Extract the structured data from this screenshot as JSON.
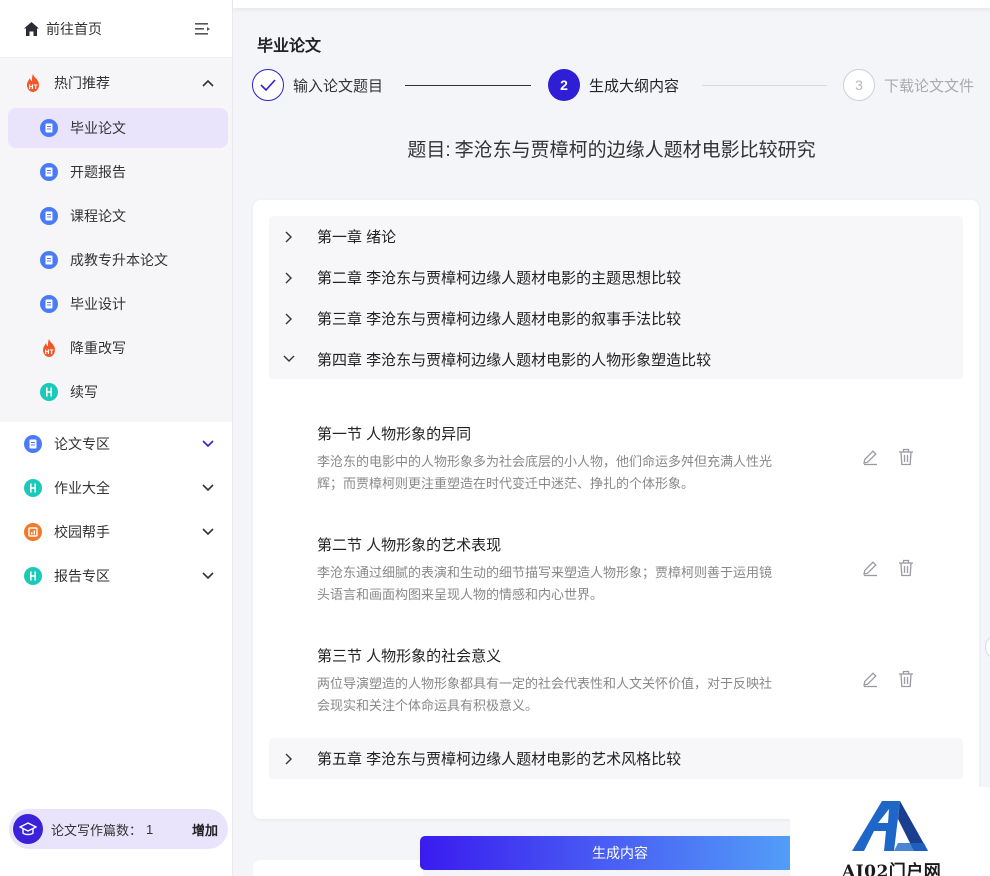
{
  "colors": {
    "primary": "#2e1fd6",
    "active_bg": "#e9e4fb",
    "hot": "#f0582c",
    "doc_blue": "#4a7bf7",
    "teal": "#1cc9b9",
    "orange": "#f07a2c"
  },
  "sidebar": {
    "home": {
      "label": "前往首页",
      "icon": "home-icon"
    },
    "hot": {
      "label": "热门推荐",
      "icon": "hot-fire-icon",
      "items": [
        {
          "label": "毕业论文",
          "icon": "document-icon",
          "active": true
        },
        {
          "label": "开题报告",
          "icon": "document-icon"
        },
        {
          "label": "课程论文",
          "icon": "document-icon"
        },
        {
          "label": "成教专升本论文",
          "icon": "document-icon"
        },
        {
          "label": "毕业设计",
          "icon": "document-icon"
        },
        {
          "label": "降重改写",
          "icon": "fire-icon"
        },
        {
          "label": "续写",
          "icon": "continue-icon"
        }
      ]
    },
    "groups": [
      {
        "label": "论文专区",
        "icon": "document-icon",
        "chevron_color": "#2e1fd6"
      },
      {
        "label": "作业大全",
        "icon": "homework-icon"
      },
      {
        "label": "校园帮手",
        "icon": "campus-icon"
      },
      {
        "label": "报告专区",
        "icon": "report-icon"
      }
    ],
    "quota": {
      "label": "论文写作篇数：",
      "count": "1",
      "add_label": "增加"
    }
  },
  "page": {
    "title": "毕业论文"
  },
  "steps": [
    {
      "label": "输入论文题目",
      "state": "done"
    },
    {
      "number": "2",
      "label": "生成大纲内容",
      "state": "active"
    },
    {
      "number": "3",
      "label": "下载论文文件",
      "state": "pending"
    }
  ],
  "topic": {
    "prefix": "题目:",
    "text": "李沧东与贾樟柯的边缘人题材电影比较研究"
  },
  "outline": {
    "chapters_top": [
      {
        "label": "第一章 绪论"
      },
      {
        "label": "第二章 李沧东与贾樟柯边缘人题材电影的主题思想比较"
      },
      {
        "label": "第三章 李沧东与贾樟柯边缘人题材电影的叙事手法比较"
      },
      {
        "label": "第四章 李沧东与贾樟柯边缘人题材电影的人物形象塑造比较"
      }
    ],
    "sections": [
      {
        "title": "第一节 人物形象的异同",
        "desc": "李沧东的电影中的人物形象多为社会底层的小人物，他们命运多舛但充满人性光辉；而贾樟柯则更注重塑造在时代变迁中迷茫、挣扎的个体形象。"
      },
      {
        "title": "第二节 人物形象的艺术表现",
        "desc": "李沧东通过细腻的表演和生动的细节描写来塑造人物形象；贾樟柯则善于运用镜头语言和画面构图来呈现人物的情感和内心世界。"
      },
      {
        "title": "第三节 人物形象的社会意义",
        "desc": "两位导演塑造的人物形象都具有一定的社会代表性和人文关怀价值，对于反映社会现实和关注个体命运具有积极意义。"
      }
    ],
    "chapter_bottom": {
      "label": "第五章 李沧东与贾樟柯边缘人题材电影的艺术风格比较"
    }
  },
  "actions": {
    "generate_label": "生成内容"
  },
  "watermark": {
    "text": "AI02门户网"
  }
}
